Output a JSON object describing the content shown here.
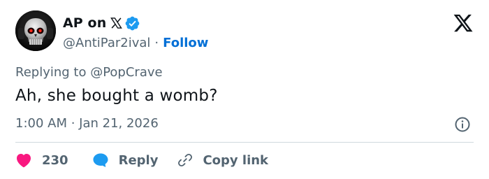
{
  "author": {
    "display_name": "AP on",
    "x_mark": "𝕏",
    "handle": "@AntiPar2ival",
    "separator": "·",
    "follow_label": "Follow",
    "avatar_icon": "skull-headphones-avatar"
  },
  "tweet": {
    "reply_context": "Replying to @PopCrave",
    "text": "Ah, she bought a womb?",
    "timestamp": "1:00 AM · Jan 21, 2026"
  },
  "actions": {
    "like_count": "230",
    "reply_label": "Reply",
    "copy_link_label": "Copy link"
  },
  "colors": {
    "verified_blue": "#1d9bf0",
    "link_blue": "#006fd6",
    "heart_pink": "#f91880",
    "secondary_text": "#536471",
    "primary_text": "#0f1419",
    "divider": "#cfd9de"
  }
}
